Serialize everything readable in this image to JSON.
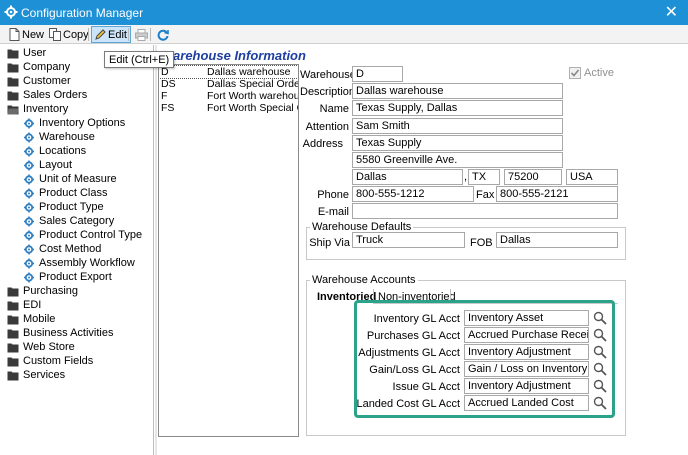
{
  "window": {
    "title": "Configuration Manager",
    "close_glyph": "✕"
  },
  "toolbar": {
    "new_label": "New",
    "copy_label": "Copy",
    "edit_label": "Edit",
    "edit_tooltip": "Edit (Ctrl+E)"
  },
  "tree": {
    "items": [
      {
        "label": "User",
        "icon": "folder-icon"
      },
      {
        "label": "Company",
        "icon": "folder-icon"
      },
      {
        "label": "Customer",
        "icon": "folder-icon"
      },
      {
        "label": "Sales Orders",
        "icon": "folder-icon"
      },
      {
        "label": "Inventory",
        "icon": "folder-open-icon"
      },
      {
        "label": "Inventory Options",
        "icon": "settings-icon"
      },
      {
        "label": "Warehouse",
        "icon": "settings-icon"
      },
      {
        "label": "Locations",
        "icon": "settings-icon"
      },
      {
        "label": "Layout",
        "icon": "settings-icon"
      },
      {
        "label": "Unit of Measure",
        "icon": "settings-icon"
      },
      {
        "label": "Product Class",
        "icon": "settings-icon"
      },
      {
        "label": "Product Type",
        "icon": "settings-icon"
      },
      {
        "label": "Sales Category",
        "icon": "settings-icon"
      },
      {
        "label": "Product Control Type",
        "icon": "settings-icon"
      },
      {
        "label": "Cost Method",
        "icon": "settings-icon"
      },
      {
        "label": "Assembly Workflow",
        "icon": "settings-icon"
      },
      {
        "label": "Product Export",
        "icon": "settings-icon"
      },
      {
        "label": "Purchasing",
        "icon": "folder-icon"
      },
      {
        "label": "EDI",
        "icon": "folder-icon"
      },
      {
        "label": "Mobile",
        "icon": "folder-icon"
      },
      {
        "label": "Business Activities",
        "icon": "folder-icon"
      },
      {
        "label": "Web Store",
        "icon": "folder-icon"
      },
      {
        "label": "Custom Fields",
        "icon": "folder-icon"
      },
      {
        "label": "Services",
        "icon": "folder-icon"
      }
    ]
  },
  "main": {
    "section_title": "Warehouse Information",
    "warehouses": [
      {
        "code": "D",
        "name": "Dallas warehouse",
        "selected": true
      },
      {
        "code": "DS",
        "name": "Dallas Special Orders",
        "selected": false
      },
      {
        "code": "F",
        "name": "Fort Worth warehouse",
        "selected": false
      },
      {
        "code": "FS",
        "name": "Fort Worth Special Orders",
        "selected": false
      }
    ],
    "form": {
      "warehouse_label": "Warehouse",
      "warehouse_value": "D",
      "active_label": "Active",
      "active_checked": true,
      "description_label": "Description",
      "description_value": "Dallas warehouse",
      "name_label": "Name",
      "name_value": "Texas Supply, Dallas",
      "attention_label": "Attention",
      "attention_value": "Sam Smith",
      "address_label": "Address",
      "address_line1": "Texas Supply",
      "address_line2": "5580 Greenville Ave.",
      "city": "Dallas",
      "city_sep": ",",
      "state": "TX",
      "zip": "75200",
      "country": "USA",
      "phone_label": "Phone",
      "phone_value": "800-555-1212",
      "fax_label": "Fax",
      "fax_value": "800-555-2121",
      "email_label": "E-mail",
      "email_value": ""
    },
    "defaults": {
      "title": "Warehouse Defaults",
      "ship_via_label": "Ship Via",
      "ship_via_value": "Truck",
      "fob_label": "FOB",
      "fob_value": "Dallas"
    },
    "accounts": {
      "title": "Warehouse Accounts",
      "tabs": [
        {
          "label": "Inventoried",
          "selected": true
        },
        {
          "label": "Non-inventoried",
          "selected": false
        }
      ],
      "highlight_color": "#2aa38a",
      "rows": [
        {
          "label": "Inventory GL Acct",
          "value": "Inventory Asset"
        },
        {
          "label": "Purchases GL Acct",
          "value": "Accrued Purchase Receipts"
        },
        {
          "label": "Adjustments GL Acct",
          "value": "Inventory Adjustment"
        },
        {
          "label": "Gain/Loss GL Acct",
          "value": "Gain / Loss on Inventory"
        },
        {
          "label": "Issue GL Acct",
          "value": "Inventory Adjustment"
        },
        {
          "label": "Landed Cost GL Acct",
          "value": "Accrued Landed Cost"
        }
      ]
    }
  }
}
